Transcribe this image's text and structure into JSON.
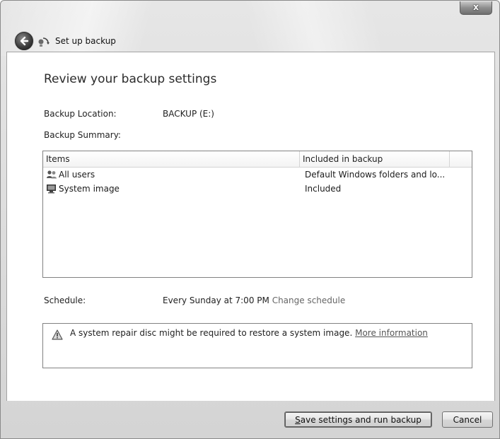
{
  "window": {
    "title": "Set up backup",
    "close_label": "x"
  },
  "main": {
    "heading": "Review your backup settings",
    "backup_location_label": "Backup Location:",
    "backup_location_value": "BACKUP (E:)",
    "backup_summary_label": "Backup Summary:",
    "list": {
      "columns": [
        "Items",
        "Included in backup"
      ],
      "rows": [
        {
          "icon": "users-icon",
          "item": "All users",
          "included": "Default Windows folders and lo..."
        },
        {
          "icon": "system-image-icon",
          "item": "System image",
          "included": "Included"
        }
      ]
    },
    "schedule_label": "Schedule:",
    "schedule_value": "Every Sunday at 7:00 PM",
    "change_schedule_link": "Change schedule",
    "warning": {
      "icon": "warning-icon",
      "text": "A system repair disc might be required to restore a system image.",
      "link": "More information"
    }
  },
  "footer": {
    "primary_button": {
      "underline_char": "S",
      "rest": "ave settings and run backup"
    },
    "cancel_button": "Cancel"
  }
}
